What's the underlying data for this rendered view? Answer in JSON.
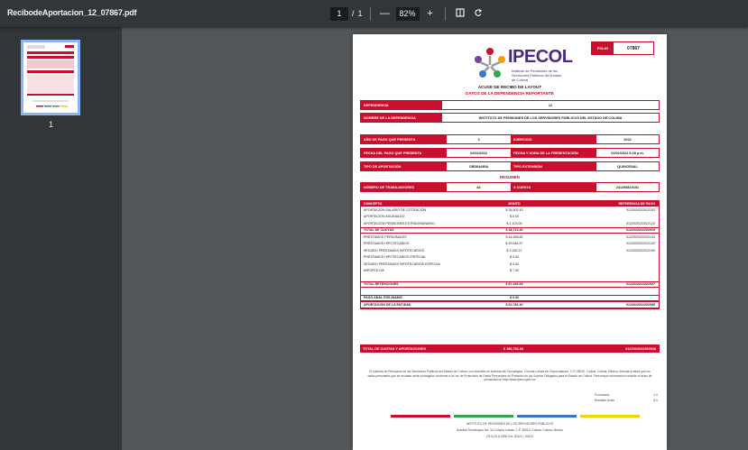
{
  "toolbar": {
    "filename": "RecibodeAportacion_12_07867.pdf",
    "page_current": "1",
    "page_sep": "/",
    "page_total": "1",
    "zoom_out": "—",
    "zoom": "82%",
    "zoom_in": "+",
    "fit_icon": "fit-page-icon",
    "rotate_icon": "rotate-icon"
  },
  "sidebar": {
    "thumb_label": "1"
  },
  "doc": {
    "logo_title": "IPECOL",
    "logo_sub": "Instituto de Pensiones de los Servidores Públicos del Estado de Colima",
    "folio_label": "FOLIO",
    "folio_value": "07867",
    "heading": "ACUSE DE RECIBO DE LAYOUT",
    "subheading": "DATOS DE LA DEPENDENCIA REPORTANTE",
    "dependencia_label": "DEPENDENCIA",
    "dependencia_value": "12",
    "nombre_label": "NOMBRE DE LA DEPENDENCIA",
    "nombre_value": "INSTITUTO DE PENSIONES DE LOS SERVIDORES PÚBLICOS DEL ESTADO DE COLIMA",
    "grid": [
      {
        "l1": "AÑO DE PAGO QUE PRESENTA",
        "v1": "3",
        "l2": "EJERCICIO",
        "v2": "2022"
      },
      {
        "l1": "FECHA DEL PAGO QUE PRESENTA",
        "v1": "02/02/2022",
        "l2": "FECHA Y HORA DE LA PRESENTACIÓN",
        "v2": "02/02/2022 9:28 p.m."
      },
      {
        "l1": "TIPO DE APORTACIÓN",
        "v1": "ORDINARIA",
        "l2": "TIPO EXTENSIÓN",
        "v2": "QUINCENAL"
      }
    ],
    "resumen": "RESUMEN",
    "resumen_row": {
      "l1": "NÚMERO DE TRABAJADORES",
      "v1": "84",
      "l2": "A CUENTA",
      "v2": "241298819151"
    },
    "cols": {
      "c1": "CONCEPTO",
      "c2": "MONTO",
      "c3": "REFERENCIA DE PAGO"
    },
    "rows": [
      {
        "c1": "APORTACIÓN SALARIO DE COTIZACIÓN",
        "c2": "$ 35,502.43",
        "c3": "0122020322022103",
        "b": false
      },
      {
        "c1": "APORTACIÓN AGUINALDO",
        "c2": "$ 0.00",
        "c3": "",
        "b": false
      },
      {
        "c1": "APORTACIÓN PENSIONES EXTRAORDINARIO",
        "c2": "$ 1,103.05",
        "c3": "0122020322022120",
        "b": false
      },
      {
        "c1": "TOTAL DE CUOTAS",
        "c2": "$ 38,723.40",
        "c3": "0122022022202919",
        "b": true
      },
      {
        "c1": "PRÉSTAMOS PERSONALES",
        "c2": "$ 44,658.82",
        "c3": "0122020322022134",
        "b": false
      },
      {
        "c1": "PRÉSTAMOS HIPOTECARIOS",
        "c2": "$ 39,648.57",
        "c3": "0122020322022142",
        "b": false
      },
      {
        "c1": "SEGURO PRÉSTAMOS HIPOTECARIOS",
        "c2": "$ 3,182.37",
        "c3": "0122020322022159",
        "b": false
      },
      {
        "c1": "PRÉSTAMOS HIPOTECARIOS ESPECIAL",
        "c2": "$ 0.00",
        "c3": "",
        "b": false
      },
      {
        "c1": "SEGURO PRÉSTAMOS HIPOTECARIOS ESPECIAL",
        "c2": "$ 0.00",
        "c3": "",
        "b": false
      },
      {
        "c1": "IMPORTE IVA",
        "c2": "$ 7.00",
        "c3": "",
        "b": false
      },
      {
        "c1": "",
        "c2": "",
        "c3": "",
        "b": false
      },
      {
        "c1": "TOTAL RETENCIONES",
        "c2": "$ 87,335.69",
        "c3": "0122022022202927",
        "b": true
      },
      {
        "c1": "",
        "c2": "",
        "c3": "",
        "b": false
      },
      {
        "c1": "PAGO ANAL ESS-INAMIC",
        "c2": "$ 0.00",
        "c3": "",
        "b": true
      },
      {
        "c1": "APORTACIÓN DE LA ENTIDAD",
        "c2": "$ 62,781.40",
        "c3": "0122022022202935",
        "b": true
      }
    ],
    "total_label": "TOTAL DE CUOTAS Y APORTACIONES",
    "total_value": "$ 188,782.83",
    "total_ref": "0122022022202943",
    "footer_text": "El Instituto de Pensiones de los Servidores Públicos del Estado de Colima, con domicilio en Avenida del Tecnológico, Colonia Lomas de Circunvalación, C.P. 28010, Colima, Colima, México, informa a usted que los datos personales que se recaban serán protegidos conforme a la Ley de Protección de Datos Personales en Posesión de los Sujetos Obligados para el Estado de Colima. Para mayor información consulte el aviso de privacidad en http://www.ipecol.gob.mx",
    "sig1_label": "Procesado",
    "sig1_value": "1.0",
    "sig2_label": "Recibido Aviso",
    "sig2_value": "8.0",
    "bar_colors": [
      "#c8102e",
      "#2fa84f",
      "#3b78c4",
      "#f3d400"
    ],
    "addr1": "INSTITUTO DE PENSIONES DE LOS SERVIDORES PÚBLICOS",
    "addr2": "Avenida Tecnológico No. 10 Colonia Lomas, C.P. 28010, Colima, Colima, México",
    "addr3": "(312) 31 6 2530 Ext. 30121 - 30222"
  }
}
